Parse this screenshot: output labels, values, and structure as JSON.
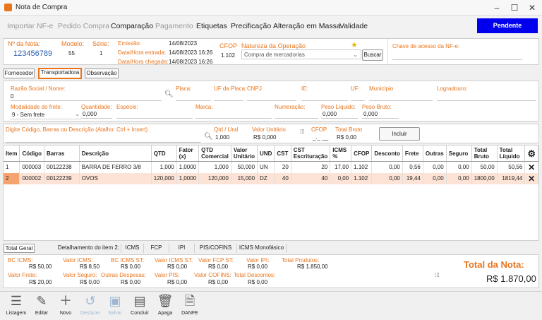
{
  "window": {
    "title": "Nota de Compra",
    "minimize": "–",
    "maximize": "☐",
    "close": "✕"
  },
  "menu": [
    "Importar NF-e",
    "Pedido Compra",
    "Comparação",
    "Pagamento",
    "Etiquetas",
    "Precificação",
    "Alteração em Massa",
    "Validade"
  ],
  "status_button": "Pendente",
  "header": {
    "nota_label": "Nº da Nota:",
    "nota_value": "123456789",
    "modelo_label": "Modelo:",
    "modelo_value": "55",
    "serie_label": "Série:",
    "serie_value": "1",
    "emissao_label": "Emissão:",
    "emissao_value": "14/08/2023",
    "entrada_label": "Data/Hora entrada:",
    "entrada_value": "14/08/2023  16:26",
    "chegada_label": "Data/Hora chegada:",
    "chegada_value": "14/08/2023  16:26",
    "cfop_label": "CFOP",
    "cfop_value": "1.102",
    "natureza_label": "Natureza da Operação",
    "natureza_value": "Compra de mercadorias",
    "buscar": "Buscar",
    "chave_label": "Chave de acesso da NF-e:"
  },
  "tabs": [
    "Fornecedor",
    "Transportadora",
    "Observação"
  ],
  "transportadora": {
    "razao_label": "Razão Social / Nome:",
    "razao_value": "0",
    "placa_label": "Placa:",
    "uf_placa_label": "UF da Placa:",
    "cnpj_label": "CNPJ",
    "ie_label": "IE:",
    "uf_label": "UF:",
    "municipio_label": "Município",
    "logradouro_label": "Logradouro:",
    "modalidade_label": "Modalidade do frete:",
    "modalidade_value": "9 - Sem frete",
    "quantidade_label": "Quantidade:",
    "quantidade_value": "0,000",
    "especie_label": "Espécie:",
    "marca_label": "Marca:",
    "numeracao_label": "Numeração:",
    "peso_liq_label": "Peso Líquido:",
    "peso_liq_value": "0,000",
    "peso_bruto_label": "Peso Bruto:",
    "peso_bruto_value": "0,000"
  },
  "entry": {
    "prompt": "Digite Código, Barras ou Descrição (Atalho: Ctrl + Insert)",
    "qtd_label": "Qtd / Und",
    "qtd_value": "1,000",
    "valor_label": "Valor Unitário",
    "valor_value": "R$ 0,000",
    "cfop_label": "CFOP",
    "cfop_value": "_._ __",
    "total_label": "Total Bruto",
    "total_value": "R$ 0,00",
    "incluir": "Incluir"
  },
  "grid": {
    "columns": [
      "Item",
      "Código",
      "Barras",
      "Descrição",
      "QTD",
      "Fator (x)",
      "QTD Comercial",
      "Valor Unitário",
      "UND",
      "CST",
      "CST Escrituração",
      "ICMS %",
      "CFOP",
      "Desconto",
      "Frete",
      "Outras",
      "Seguro",
      "Total Bruto",
      "Total Líquido"
    ],
    "rows": [
      [
        "1",
        "000003",
        "00122238",
        "BARRA DE FERRO 3/8",
        "1,000",
        "1,0000",
        "1,000",
        "50,000",
        "UN",
        "20",
        "20",
        "17,00",
        "1.102",
        "0,00",
        "0,56",
        "0,00",
        "0,00",
        "50,00",
        "50,56"
      ],
      [
        "2",
        "000002",
        "00122239",
        "OVOS",
        "120,000",
        "1,0000",
        "120,000",
        "15,000",
        "DZ",
        "40",
        "40",
        "0,00",
        "1.102",
        "0,00",
        "19,44",
        "0,00",
        "0,00",
        "1800,00",
        "1819,44"
      ]
    ]
  },
  "bottom_tabs": [
    "Total Geral",
    "Detalhamento do item 2:",
    "ICMS",
    "FCP",
    "IPI",
    "PIS/COFINS",
    "ICMS Monofásico"
  ],
  "totals": {
    "bc_icms_l": "BC ICMS:",
    "bc_icms_v": "R$ 50,00",
    "valor_icms_l": "Valor ICMS:",
    "valor_icms_v": "R$ 8,50",
    "bc_icms_st_l": "BC ICMS ST:",
    "bc_icms_st_v": "R$ 0,00",
    "valor_icms_st_l": "Valor ICMS ST:",
    "valor_icms_st_v": "R$ 0,00",
    "valor_fcp_st_l": "Valor FCP ST:",
    "valor_fcp_st_v": "R$ 0,00",
    "valor_ipi_l": "Valor IPI:",
    "valor_ipi_v": "R$ 0,00",
    "total_prod_l": "Total Produtos:",
    "total_prod_v": "R$ 1.850,00",
    "valor_frete_l": "Valor Frete:",
    "valor_frete_v": "R$ 20,00",
    "valor_seguro_l": "Valor Seguro:",
    "valor_seguro_v": "R$ 0,00",
    "outras_l": "Outras Despesas:",
    "outras_v": "R$ 0,00",
    "valor_pis_l": "Valor PIS:",
    "valor_pis_v": "R$ 0,00",
    "valor_cofins_l": "Valor COFINS:",
    "valor_cofins_v": "R$ 0,00",
    "total_desc_l": "Total Descontos:",
    "total_desc_v": "R$ 0,00",
    "total_nota_l": "Total da Nota:",
    "total_nota_v": "R$ 1.870,00"
  },
  "toolbar": [
    "Listagem",
    "Editar",
    "Novo",
    "Desfazer",
    "Salvar",
    "Concluir",
    "Apaga",
    "DANFE"
  ],
  "colors": {
    "accent": "#e8741c",
    "status": "#0000ee",
    "selected_row": "#fde3d5"
  }
}
